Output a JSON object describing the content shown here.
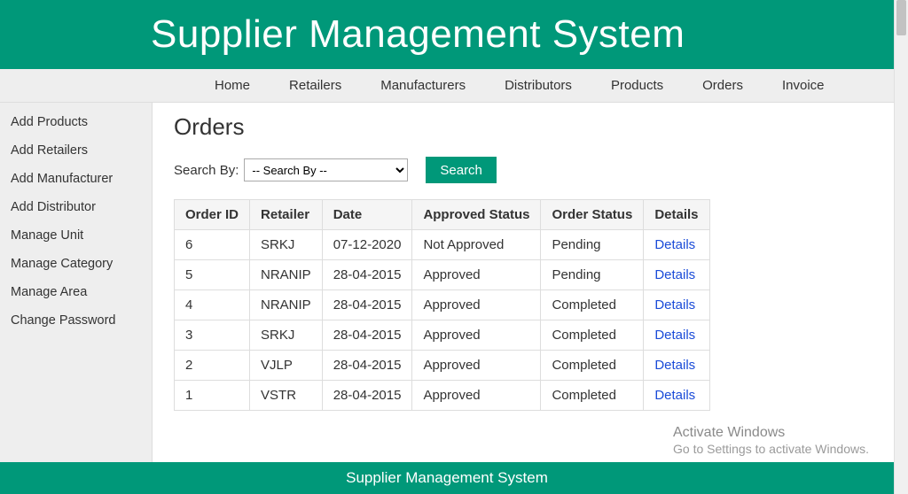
{
  "header": {
    "title": "Supplier Management System"
  },
  "topnav": {
    "items": [
      {
        "label": "Home"
      },
      {
        "label": "Retailers"
      },
      {
        "label": "Manufacturers"
      },
      {
        "label": "Distributors"
      },
      {
        "label": "Products"
      },
      {
        "label": "Orders"
      },
      {
        "label": "Invoice"
      }
    ]
  },
  "sidebar": {
    "items": [
      {
        "label": "Add Products"
      },
      {
        "label": "Add Retailers"
      },
      {
        "label": "Add Manufacturer"
      },
      {
        "label": "Add Distributor"
      },
      {
        "label": "Manage Unit"
      },
      {
        "label": "Manage Category"
      },
      {
        "label": "Manage Area"
      },
      {
        "label": "Change Password"
      }
    ]
  },
  "page": {
    "title": "Orders"
  },
  "search": {
    "label": "Search By:",
    "placeholder": "-- Search By --",
    "button": "Search"
  },
  "table": {
    "headers": {
      "order_id": "Order ID",
      "retailer": "Retailer",
      "date": "Date",
      "approved_status": "Approved Status",
      "order_status": "Order Status",
      "details": "Details"
    },
    "details_link_label": "Details",
    "rows": [
      {
        "order_id": "6",
        "retailer": "SRKJ",
        "date": "07-12-2020",
        "approved_status": "Not Approved",
        "order_status": "Pending"
      },
      {
        "order_id": "5",
        "retailer": "NRANIP",
        "date": "28-04-2015",
        "approved_status": "Approved",
        "order_status": "Pending"
      },
      {
        "order_id": "4",
        "retailer": "NRANIP",
        "date": "28-04-2015",
        "approved_status": "Approved",
        "order_status": "Completed"
      },
      {
        "order_id": "3",
        "retailer": "SRKJ",
        "date": "28-04-2015",
        "approved_status": "Approved",
        "order_status": "Completed"
      },
      {
        "order_id": "2",
        "retailer": "VJLP",
        "date": "28-04-2015",
        "approved_status": "Approved",
        "order_status": "Completed"
      },
      {
        "order_id": "1",
        "retailer": "VSTR",
        "date": "28-04-2015",
        "approved_status": "Approved",
        "order_status": "Completed"
      }
    ]
  },
  "footer": {
    "text": "Supplier Management System"
  },
  "watermark": {
    "title": "Activate Windows",
    "subtitle": "Go to Settings to activate Windows."
  },
  "colors": {
    "accent": "#009879",
    "link": "#1a4bd8"
  }
}
